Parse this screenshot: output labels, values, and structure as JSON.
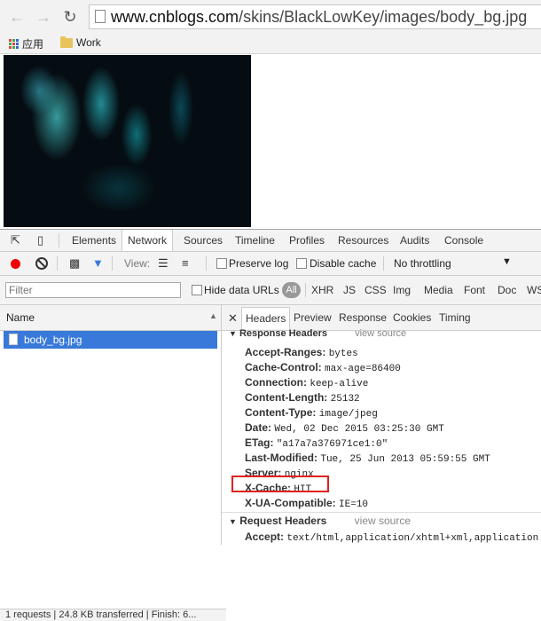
{
  "browser": {
    "url_host": "www.cnblogs.com",
    "url_path": "/skins/BlackLowKey/images/body_bg.jpg",
    "bookmarks": [
      "应用",
      "Work"
    ]
  },
  "devtools": {
    "tabs": [
      "Elements",
      "Network",
      "Sources",
      "Timeline",
      "Profiles",
      "Resources",
      "Audits",
      "Console"
    ],
    "active_tab": "Network",
    "toolbar": {
      "view_label": "View:",
      "preserve_log": "Preserve log",
      "disable_cache": "Disable cache",
      "throttling": "No throttling"
    },
    "filter": {
      "placeholder": "Filter",
      "hide_data_urls": "Hide data URLs",
      "all": "All",
      "types": [
        "XHR",
        "JS",
        "CSS",
        "Img",
        "Media",
        "Font",
        "Doc",
        "WS"
      ]
    },
    "requests": {
      "column": "Name",
      "files": [
        "body_bg.jpg"
      ],
      "status": "1 requests | 24.8 KB transferred | Finish: 6..."
    },
    "detail_tabs": [
      "Headers",
      "Preview",
      "Response",
      "Cookies",
      "Timing"
    ],
    "response_headers": {
      "title": "Response Headers",
      "view_source": "view source",
      "items": [
        {
          "key": "Accept-Ranges:",
          "value": "bytes"
        },
        {
          "key": "Cache-Control:",
          "value": "max-age=86400"
        },
        {
          "key": "Connection:",
          "value": "keep-alive"
        },
        {
          "key": "Content-Length:",
          "value": "25132"
        },
        {
          "key": "Content-Type:",
          "value": "image/jpeg"
        },
        {
          "key": "Date:",
          "value": "Wed, 02 Dec 2015 03:25:30 GMT"
        },
        {
          "key": "ETag:",
          "value": "\"a17a7a376971ce1:0\""
        },
        {
          "key": "Last-Modified:",
          "value": "Tue, 25 Jun 2013 05:59:55 GMT"
        },
        {
          "key": "Server:",
          "value": "nginx"
        },
        {
          "key": "X-Cache:",
          "value": "HIT"
        },
        {
          "key": "X-UA-Compatible:",
          "value": "IE=10"
        }
      ]
    },
    "request_headers": {
      "title": "Request Headers",
      "view_source": "view source",
      "items": [
        {
          "key": "Accept:",
          "value": "text/html,application/xhtml+xml,application..."
        }
      ]
    }
  }
}
